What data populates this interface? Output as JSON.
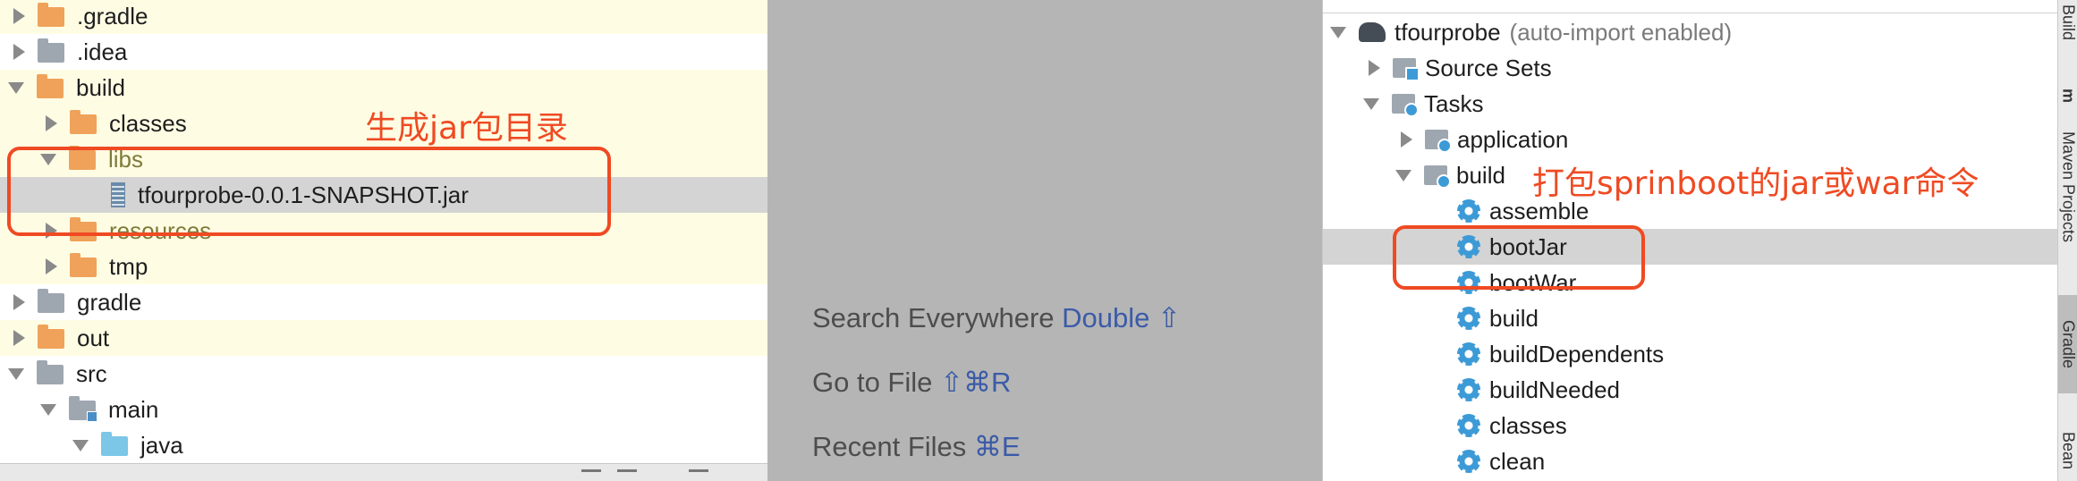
{
  "project_tree": {
    "rows": [
      {
        "label": ".gradle"
      },
      {
        "label": ".idea"
      },
      {
        "label": "build"
      },
      {
        "label": "classes"
      },
      {
        "label": "libs"
      },
      {
        "label": "tfourprobe-0.0.1-SNAPSHOT.jar"
      },
      {
        "label": "resources"
      },
      {
        "label": "tmp"
      },
      {
        "label": "gradle"
      },
      {
        "label": "out"
      },
      {
        "label": "src"
      },
      {
        "label": "main"
      },
      {
        "label": "java"
      }
    ],
    "annotation": "生成jar包目录"
  },
  "editor_hints": {
    "search_label": "Search Everywhere",
    "search_key": "Double ⇧",
    "gotofile_label": "Go to File",
    "gotofile_key": "⇧⌘R",
    "recent_label": "Recent Files",
    "recent_key": "⌘E"
  },
  "gradle_tree": {
    "root_label": "tfourprobe",
    "root_sub": "(auto-import enabled)",
    "source_sets": "Source Sets",
    "tasks": "Tasks",
    "application": "application",
    "build_group": "build",
    "items": [
      "assemble",
      "bootJar",
      "bootWar",
      "build",
      "buildDependents",
      "buildNeeded",
      "classes",
      "clean"
    ],
    "annotation": "打包sprinboot的jar或war命令"
  },
  "tool_strip": {
    "tabs": [
      "Build",
      "m",
      "Maven Projects",
      "Gradle",
      "Bean"
    ]
  },
  "colors": {
    "annotation_red": "#ef4a23",
    "key_blue": "#3b5ba8",
    "yellow_highlight": "#fefde4",
    "selected_row": "#d4d4d4"
  }
}
